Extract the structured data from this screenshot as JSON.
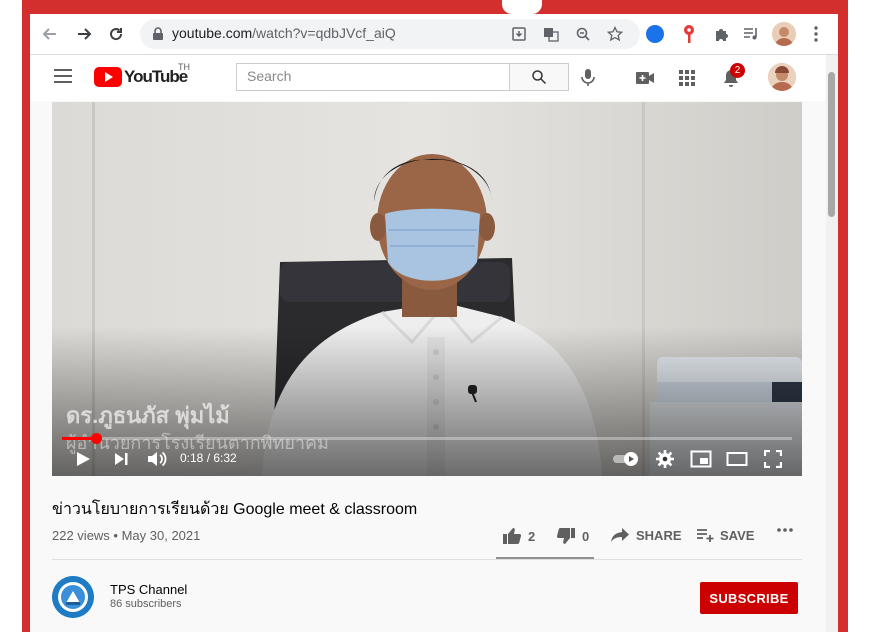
{
  "browser": {
    "url_host": "youtube.com",
    "url_path": "/watch?v=qdbJVcf_aiQ"
  },
  "youtube": {
    "logo_text": "YouTube",
    "country_code": "TH",
    "search_placeholder": "Search",
    "notification_count": "2"
  },
  "video": {
    "overlay_name": "ดร.ภูธนภัส  พุ่มไม้",
    "overlay_role": "ผู้อำนวยการโรงเรียนตากพิทยาคม",
    "time_current": "0:18",
    "time_total": "6:32",
    "time_display": "0:18 / 6:32",
    "progress_fraction": 0.046
  },
  "info": {
    "title": "ข่าวนโยบายการเรียนด้วย Google meet & classroom",
    "views_date": "222 views • May 30, 2021",
    "likes": "2",
    "dislikes": "0",
    "share_label": "SHARE",
    "save_label": "SAVE"
  },
  "channel": {
    "name": "TPS Channel",
    "subscribers": "86 subscribers",
    "subscribe_label": "SUBSCRIBE"
  },
  "colors": {
    "accent": "#ff0000",
    "subscribe": "#cc0000",
    "frame": "#d32f2f"
  }
}
